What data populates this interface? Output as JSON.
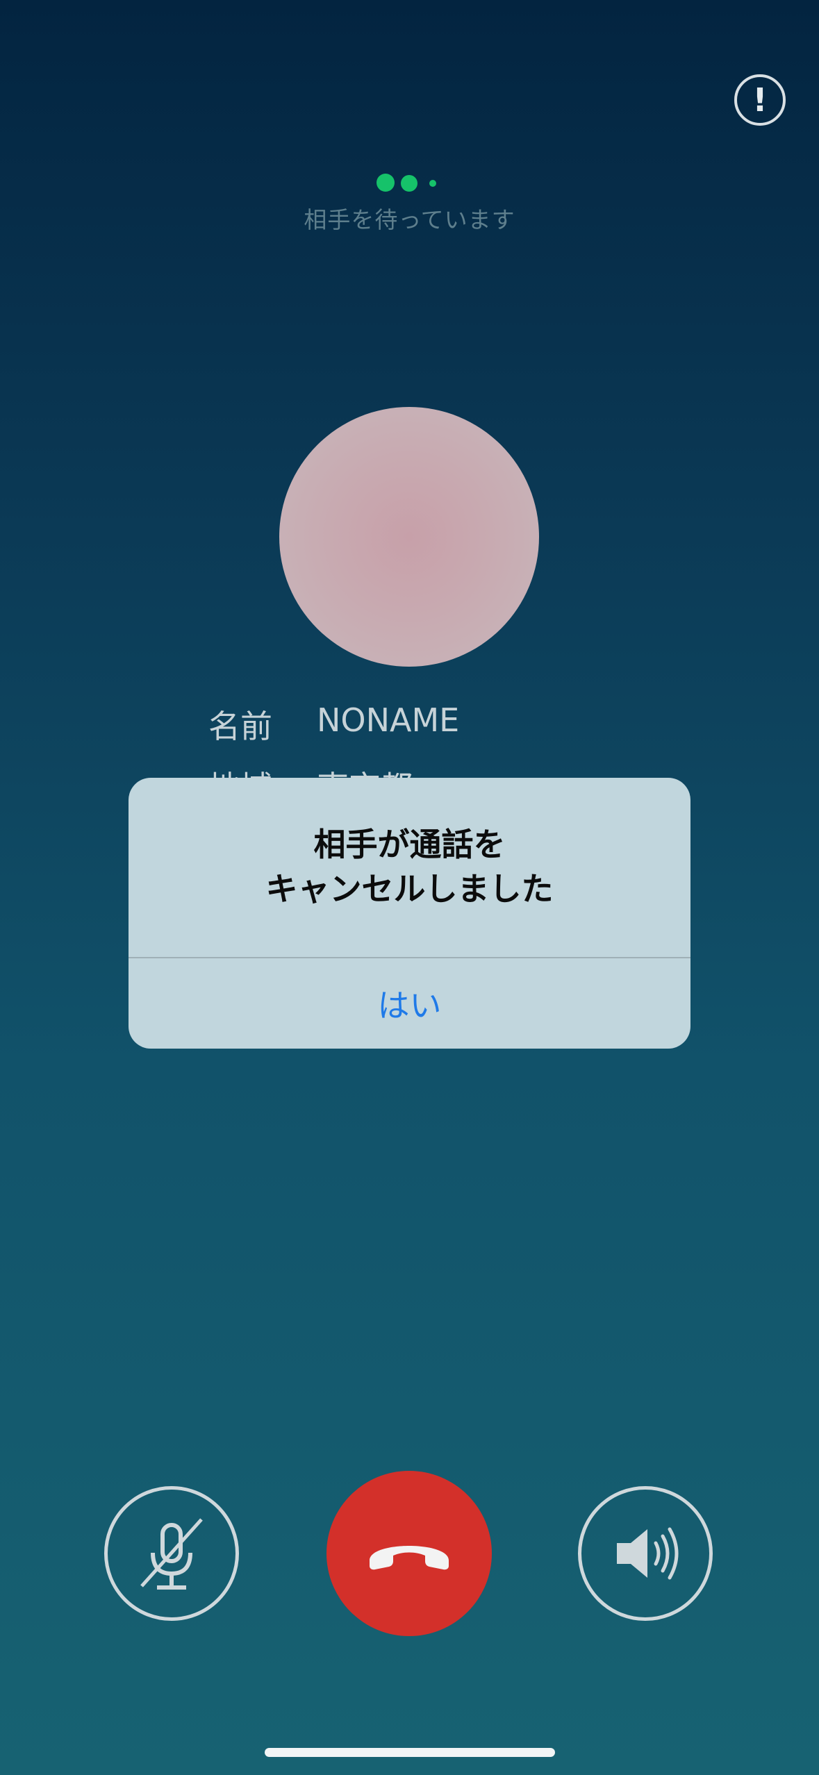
{
  "status": {
    "waiting_text": "相手を待っています",
    "dot_color": "#16c26a"
  },
  "icons": {
    "report": "exclamation-circle-icon",
    "mute": "microphone-off-icon",
    "end_call": "phone-hangup-icon",
    "speaker": "speaker-icon"
  },
  "report_glyph": "!",
  "profile": {
    "rows": [
      {
        "key": "名前",
        "value": "NONAME"
      },
      {
        "key": "地域",
        "value": "東京都"
      }
    ]
  },
  "alert": {
    "title_line1": "相手が通話を",
    "title_line2": "キャンセルしました",
    "confirm_label": "はい"
  },
  "colors": {
    "end_call": "#d3302a",
    "alert_button": "#1f7ae8",
    "background_top": "#032440",
    "background_bottom": "#176272"
  }
}
